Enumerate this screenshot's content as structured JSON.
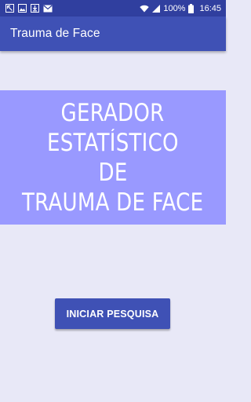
{
  "status_bar": {
    "battery_percent": "100%",
    "time": "16:45",
    "icons": [
      "missed-call-icon",
      "image-icon",
      "download-icon",
      "email-icon",
      "wifi-icon",
      "signal-icon",
      "battery-icon"
    ]
  },
  "app_bar": {
    "title": "Trauma de Face"
  },
  "banner": {
    "lines": [
      "GERADOR",
      "ESTATÍSTICO",
      "DE",
      "TRAUMA DE FACE"
    ]
  },
  "start_button": {
    "label": "INICIAR PESQUISA"
  },
  "colors": {
    "status_bar": "#303f9f",
    "app_bar": "#3f51b5",
    "background": "#e8e8f7",
    "banner": "#9999ff",
    "button": "#3f51b5"
  }
}
